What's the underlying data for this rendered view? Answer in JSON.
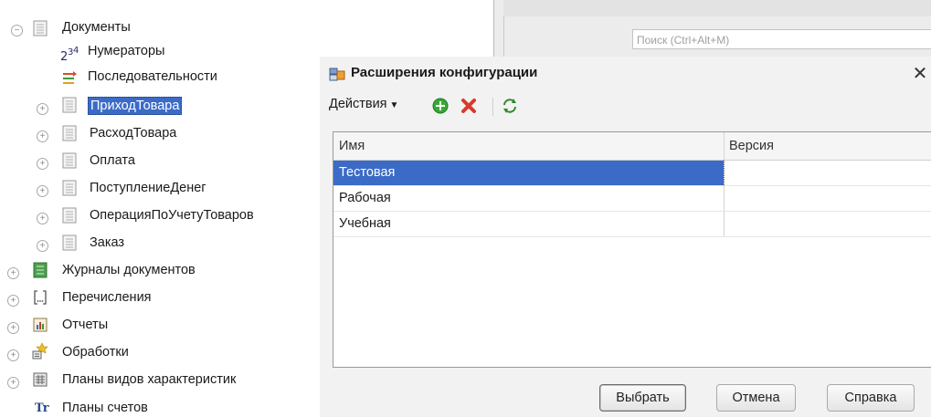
{
  "tree": {
    "documents": "Документы",
    "numerators": "Нумераторы",
    "sequences": "Последовательности",
    "doc_items": [
      "ПриходТовара",
      "РасходТовара",
      "Оплата",
      "ПоступлениеДенег",
      "ОперацияПоУчетуТоваров",
      "Заказ"
    ],
    "journals": "Журналы документов",
    "enums": "Перечисления",
    "reports": "Отчеты",
    "processing": "Обработки",
    "char_types": "Планы видов характеристик",
    "accounts": "Планы счетов"
  },
  "background": {
    "search_placeholder": "Поиск (Ctrl+Alt+M)"
  },
  "dialog": {
    "title": "Расширения конфигурации",
    "actions_label": "Действия",
    "columns": [
      "Имя",
      "Версия"
    ],
    "rows": [
      {
        "name": "Тестовая",
        "version": ""
      },
      {
        "name": "Рабочая",
        "version": ""
      },
      {
        "name": "Учебная",
        "version": ""
      }
    ],
    "selected_row": "Тестовая",
    "buttons": {
      "select": "Выбрать",
      "cancel": "Отмена",
      "help": "Справка"
    }
  },
  "colors": {
    "selection": "#3b6bc7",
    "add_green": "#36a936",
    "delete_red": "#d83a2b"
  }
}
